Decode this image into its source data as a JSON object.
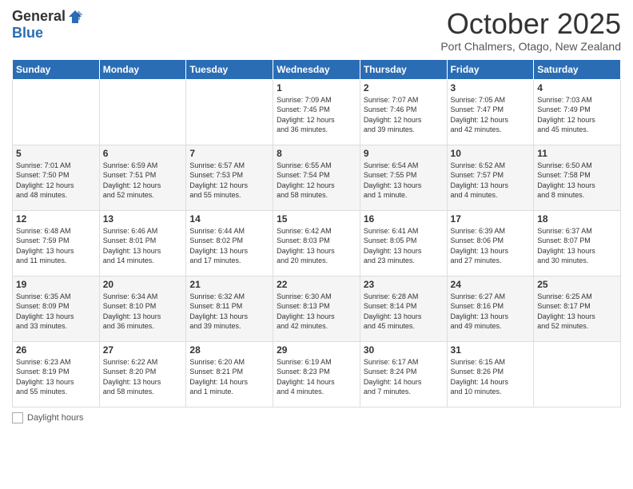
{
  "header": {
    "logo_general": "General",
    "logo_blue": "Blue",
    "month_title": "October 2025",
    "subtitle": "Port Chalmers, Otago, New Zealand"
  },
  "weekdays": [
    "Sunday",
    "Monday",
    "Tuesday",
    "Wednesday",
    "Thursday",
    "Friday",
    "Saturday"
  ],
  "weeks": [
    [
      {
        "day": "",
        "info": ""
      },
      {
        "day": "",
        "info": ""
      },
      {
        "day": "",
        "info": ""
      },
      {
        "day": "1",
        "info": "Sunrise: 7:09 AM\nSunset: 7:45 PM\nDaylight: 12 hours\nand 36 minutes."
      },
      {
        "day": "2",
        "info": "Sunrise: 7:07 AM\nSunset: 7:46 PM\nDaylight: 12 hours\nand 39 minutes."
      },
      {
        "day": "3",
        "info": "Sunrise: 7:05 AM\nSunset: 7:47 PM\nDaylight: 12 hours\nand 42 minutes."
      },
      {
        "day": "4",
        "info": "Sunrise: 7:03 AM\nSunset: 7:49 PM\nDaylight: 12 hours\nand 45 minutes."
      }
    ],
    [
      {
        "day": "5",
        "info": "Sunrise: 7:01 AM\nSunset: 7:50 PM\nDaylight: 12 hours\nand 48 minutes."
      },
      {
        "day": "6",
        "info": "Sunrise: 6:59 AM\nSunset: 7:51 PM\nDaylight: 12 hours\nand 52 minutes."
      },
      {
        "day": "7",
        "info": "Sunrise: 6:57 AM\nSunset: 7:53 PM\nDaylight: 12 hours\nand 55 minutes."
      },
      {
        "day": "8",
        "info": "Sunrise: 6:55 AM\nSunset: 7:54 PM\nDaylight: 12 hours\nand 58 minutes."
      },
      {
        "day": "9",
        "info": "Sunrise: 6:54 AM\nSunset: 7:55 PM\nDaylight: 13 hours\nand 1 minute."
      },
      {
        "day": "10",
        "info": "Sunrise: 6:52 AM\nSunset: 7:57 PM\nDaylight: 13 hours\nand 4 minutes."
      },
      {
        "day": "11",
        "info": "Sunrise: 6:50 AM\nSunset: 7:58 PM\nDaylight: 13 hours\nand 8 minutes."
      }
    ],
    [
      {
        "day": "12",
        "info": "Sunrise: 6:48 AM\nSunset: 7:59 PM\nDaylight: 13 hours\nand 11 minutes."
      },
      {
        "day": "13",
        "info": "Sunrise: 6:46 AM\nSunset: 8:01 PM\nDaylight: 13 hours\nand 14 minutes."
      },
      {
        "day": "14",
        "info": "Sunrise: 6:44 AM\nSunset: 8:02 PM\nDaylight: 13 hours\nand 17 minutes."
      },
      {
        "day": "15",
        "info": "Sunrise: 6:42 AM\nSunset: 8:03 PM\nDaylight: 13 hours\nand 20 minutes."
      },
      {
        "day": "16",
        "info": "Sunrise: 6:41 AM\nSunset: 8:05 PM\nDaylight: 13 hours\nand 23 minutes."
      },
      {
        "day": "17",
        "info": "Sunrise: 6:39 AM\nSunset: 8:06 PM\nDaylight: 13 hours\nand 27 minutes."
      },
      {
        "day": "18",
        "info": "Sunrise: 6:37 AM\nSunset: 8:07 PM\nDaylight: 13 hours\nand 30 minutes."
      }
    ],
    [
      {
        "day": "19",
        "info": "Sunrise: 6:35 AM\nSunset: 8:09 PM\nDaylight: 13 hours\nand 33 minutes."
      },
      {
        "day": "20",
        "info": "Sunrise: 6:34 AM\nSunset: 8:10 PM\nDaylight: 13 hours\nand 36 minutes."
      },
      {
        "day": "21",
        "info": "Sunrise: 6:32 AM\nSunset: 8:11 PM\nDaylight: 13 hours\nand 39 minutes."
      },
      {
        "day": "22",
        "info": "Sunrise: 6:30 AM\nSunset: 8:13 PM\nDaylight: 13 hours\nand 42 minutes."
      },
      {
        "day": "23",
        "info": "Sunrise: 6:28 AM\nSunset: 8:14 PM\nDaylight: 13 hours\nand 45 minutes."
      },
      {
        "day": "24",
        "info": "Sunrise: 6:27 AM\nSunset: 8:16 PM\nDaylight: 13 hours\nand 49 minutes."
      },
      {
        "day": "25",
        "info": "Sunrise: 6:25 AM\nSunset: 8:17 PM\nDaylight: 13 hours\nand 52 minutes."
      }
    ],
    [
      {
        "day": "26",
        "info": "Sunrise: 6:23 AM\nSunset: 8:19 PM\nDaylight: 13 hours\nand 55 minutes."
      },
      {
        "day": "27",
        "info": "Sunrise: 6:22 AM\nSunset: 8:20 PM\nDaylight: 13 hours\nand 58 minutes."
      },
      {
        "day": "28",
        "info": "Sunrise: 6:20 AM\nSunset: 8:21 PM\nDaylight: 14 hours\nand 1 minute."
      },
      {
        "day": "29",
        "info": "Sunrise: 6:19 AM\nSunset: 8:23 PM\nDaylight: 14 hours\nand 4 minutes."
      },
      {
        "day": "30",
        "info": "Sunrise: 6:17 AM\nSunset: 8:24 PM\nDaylight: 14 hours\nand 7 minutes."
      },
      {
        "day": "31",
        "info": "Sunrise: 6:15 AM\nSunset: 8:26 PM\nDaylight: 14 hours\nand 10 minutes."
      },
      {
        "day": "",
        "info": ""
      }
    ]
  ],
  "footer": {
    "label": "Daylight hours"
  }
}
